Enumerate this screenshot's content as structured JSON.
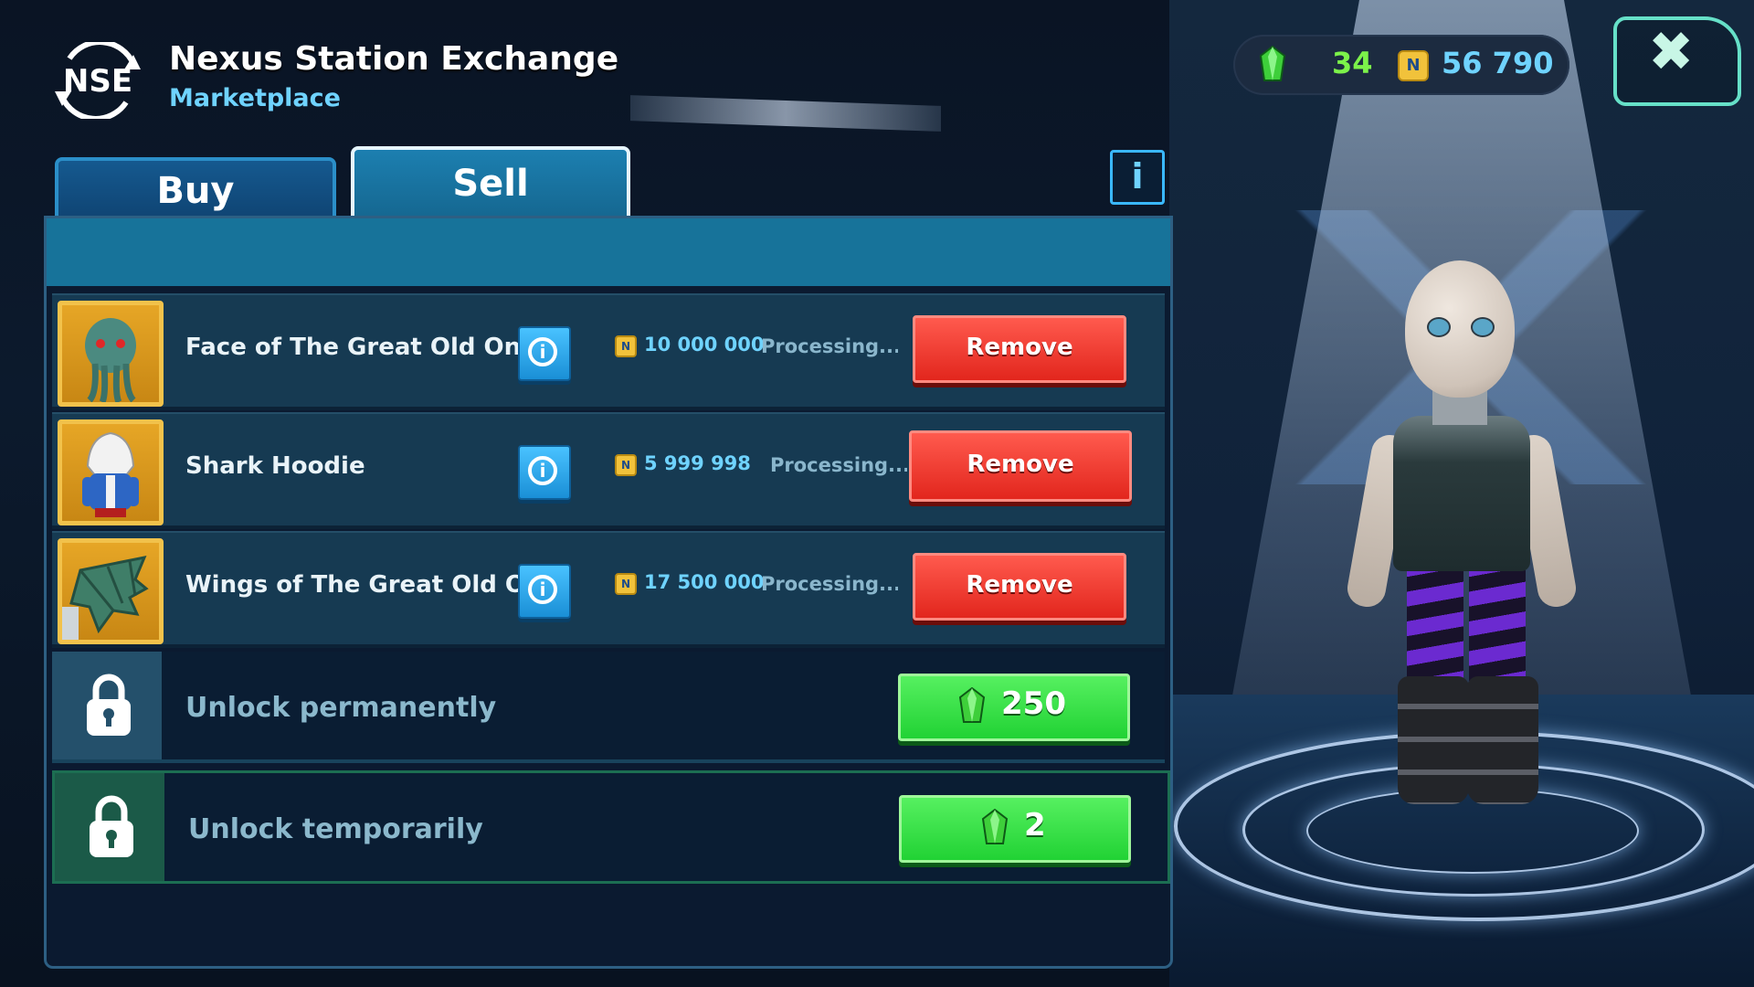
{
  "header": {
    "logo_text": "NSE",
    "title": "Nexus Station Exchange",
    "subtitle": "Marketplace"
  },
  "currency": {
    "gems": "34",
    "coins": "56 790",
    "coin_symbol": "N"
  },
  "tabs": {
    "buy": "Buy",
    "sell": "Sell",
    "active": "Sell",
    "info_glyph": "i"
  },
  "listings": [
    {
      "name": "Face of The Great Old One",
      "price": "10 000 000",
      "status": "Processing...",
      "action": "Remove"
    },
    {
      "name": "Shark Hoodie",
      "price": "5 999 998",
      "status": "Processing...",
      "action": "Remove"
    },
    {
      "name": "Wings of The Great Old One",
      "price": "17 500 000",
      "status": "Processing...",
      "action": "Remove"
    }
  ],
  "unlocks": [
    {
      "label": "Unlock permanently",
      "cost": "250"
    },
    {
      "label": "Unlock temporarily",
      "cost": "2"
    }
  ],
  "colors": {
    "accent": "#6fd3ff",
    "remove": "#e2261d",
    "gem_button": "#21d234",
    "gem": "#3ecf3a",
    "frame": "#f2c24b"
  },
  "icons": [
    "nse-logo",
    "gem-icon",
    "coin-icon",
    "close-icon",
    "info-icon",
    "lock-icon"
  ]
}
